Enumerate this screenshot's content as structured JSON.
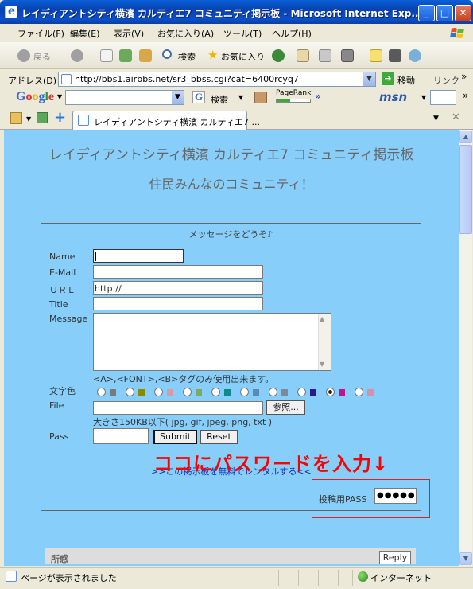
{
  "window": {
    "title": "レイディアントシティ横濱 カルティエ7 コミュニティ掲示板 - Microsoft Internet Exp...",
    "min_label": "_",
    "max_label": "□",
    "close_label": "✕"
  },
  "menu": {
    "items": [
      "ファイル(F)",
      "編集(E)",
      "表示(V)",
      "お気に入り(A)",
      "ツール(T)",
      "ヘルプ(H)"
    ]
  },
  "toolbar": {
    "back": "戻る",
    "search": "検索",
    "favorites": "お気に入り"
  },
  "address": {
    "label": "アドレス(D)",
    "url": "http://bbs1.airbbs.net/sr3_bbss.cgi?cat=6400rcyq7",
    "go": "移動",
    "links": "リンク"
  },
  "google_toolbar": {
    "logo": "Google",
    "search_label": "検索",
    "pagerank": "PageRank",
    "more": "»",
    "msn": "msn"
  },
  "tab": {
    "title": "レイディアントシティ横濱 カルティエ7 ..."
  },
  "page": {
    "title": "レイディアントシティ横濱 カルティエ7 コミュニティ掲示板",
    "subtitle": "住民みんなのコミュニティ！",
    "form": {
      "header": "メッセージをどうぞ♪",
      "name_label": "Name",
      "email_label": "E-Mail",
      "url_label": "ＵＲＬ",
      "url_value": "http://",
      "title_label": "Title",
      "message_label": "Message",
      "tag_note": "<A>,<FONT>,<B>タグのみ使用出来ます。",
      "color_label": "文字色",
      "colors": [
        "#7a7a7a",
        "#8a8a00",
        "#d99aa5",
        "#80a860",
        "#108a8a",
        "#5a8ab8",
        "#7a8a9a",
        "#2a1a8a",
        "#c0138c",
        "#d890a8"
      ],
      "selected_color_index": 8,
      "file_label": "File",
      "browse_label": "参照...",
      "file_note": "大きさ150KB以下( jpg, gif, jpeg, png, txt )",
      "pass_label": "Pass",
      "submit_label": "Submit",
      "reset_label": "Reset"
    },
    "annotation": "ココにパスワードを入力↓",
    "blue_link": ">>この掲示板を無料でレンタルする<<",
    "post_pass_label": "投稿用PASS",
    "post_pass_value": "●●●●●",
    "post": {
      "title": "所感",
      "reply_label": "Reply"
    }
  },
  "status": {
    "text": "ページが表示されました",
    "zone": "インターネット"
  }
}
